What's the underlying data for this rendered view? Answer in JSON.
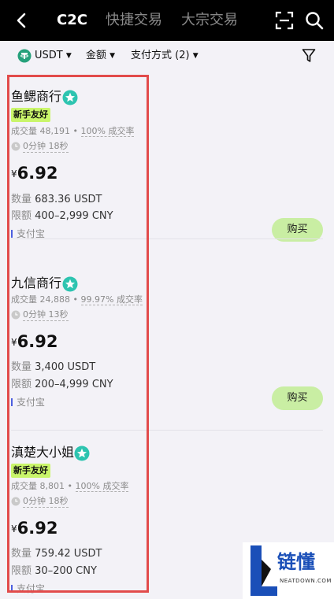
{
  "header": {
    "tabs": [
      {
        "label": "C2C",
        "active": true
      },
      {
        "label": "快捷交易",
        "active": false
      },
      {
        "label": "大宗交易",
        "active": false
      }
    ],
    "icons": [
      "back-arrow-icon",
      "scan-icon",
      "search-icon"
    ]
  },
  "filters": {
    "coin": "USDT",
    "amount": "金额",
    "payment": "支付方式 (2)",
    "icons": [
      "usdt-coin-icon",
      "caret-down-icon",
      "filter-funnel-icon"
    ]
  },
  "offers": [
    {
      "merchant": "鱼鳃商行",
      "badge": "新手友好",
      "volume_label": "成交量 48,191",
      "rate_label": "100% 成交率",
      "time": "0分钟 18秒",
      "currency_symbol": "¥",
      "price": "6.92",
      "qty_label": "数量",
      "qty": "683.36 USDT",
      "limit_label": "限额",
      "limit": "400–2,999 CNY",
      "payment": "支付宝",
      "buy_label": "购买"
    },
    {
      "merchant": "九信商行",
      "badge": "",
      "volume_label": "成交量 24,888",
      "rate_label": "99.97% 成交率",
      "time": "0分钟 13秒",
      "currency_symbol": "¥",
      "price": "6.92",
      "qty_label": "数量",
      "qty": "3,400 USDT",
      "limit_label": "限额",
      "limit": "200–4,999 CNY",
      "payment": "支付宝",
      "buy_label": "购买"
    },
    {
      "merchant": "滇楚大小姐",
      "badge": "新手友好",
      "volume_label": "成交量 8,801",
      "rate_label": "100% 成交率",
      "time": "0分钟 18秒",
      "currency_symbol": "¥",
      "price": "6.92",
      "qty_label": "数量",
      "qty": "759.42 USDT",
      "limit_label": "限额",
      "limit": "30–200 CNY",
      "payment": "支付宝",
      "buy_label": ""
    }
  ],
  "watermark": {
    "text": "链懂",
    "subtext": "NEATDOWN.COM"
  },
  "colors": {
    "topbar": "#000000",
    "background": "#f3f2f7",
    "badge": "#c9f56a",
    "buy_button": "#c9eea3",
    "highlight": "#e24b4b",
    "verified": "#2dc4b0",
    "watermark_blue": "#1a4fb8"
  }
}
